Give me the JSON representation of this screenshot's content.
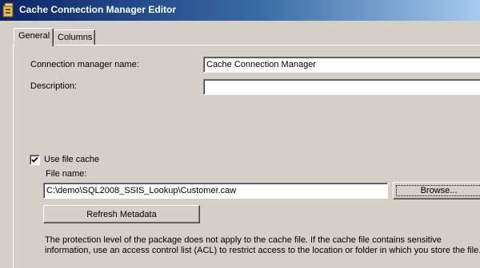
{
  "window": {
    "title": "Cache Connection Manager Editor"
  },
  "tabs": [
    {
      "label": "General",
      "active": true
    },
    {
      "label": "Columns",
      "active": false
    }
  ],
  "general": {
    "connection_name_label": "Connection manager name:",
    "connection_name_value": "Cache Connection Manager",
    "description_label": "Description:",
    "description_value": "",
    "use_file_cache_label": "Use file cache",
    "use_file_cache_checked": true,
    "file_name_label": "File name:",
    "file_name_value": "C:\\demo\\SQL2008_SSIS_Lookup\\Customer.caw",
    "browse_label": "Browse...",
    "refresh_label": "Refresh Metadata",
    "notice_line1": "The protection level of the package does not apply to the cache file. If the cache file contains sensitive",
    "notice_line2": "information, use an access control list (ACL) to restrict access to the location or folder in which you store the file."
  },
  "icons": {
    "app": "package-icon",
    "check": "checkmark-icon"
  },
  "colors": {
    "title_start": "#0a246a",
    "title_end": "#a6caf0",
    "face": "#d4d0c8"
  }
}
